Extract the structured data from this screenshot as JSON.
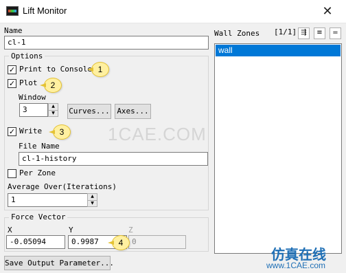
{
  "window": {
    "title": "Lift Monitor",
    "close_glyph": "✕"
  },
  "name_field": {
    "label": "Name",
    "value": "cl-1"
  },
  "options": {
    "title": "Options",
    "print_to_console": {
      "label": "Print to Console",
      "checked": true
    },
    "plot": {
      "label": "Plot",
      "checked": true
    },
    "window_label": "Window",
    "window_value": "3",
    "curves_button": "Curves...",
    "axes_button": "Axes...",
    "write": {
      "label": "Write",
      "checked": true
    },
    "file_name_label": "File Name",
    "file_name_value": "cl-1-history",
    "per_zone": {
      "label": "Per Zone",
      "checked": false
    },
    "average_over_label": "Average Over(Iterations)",
    "average_over_value": "1"
  },
  "force_vector": {
    "title": "Force Vector",
    "x_label": "X",
    "x_value": "-0.05094",
    "y_label": "Y",
    "y_value": "0.9987",
    "z_label": "Z",
    "z_value": "0"
  },
  "save_button": "Save Output Parameter...",
  "wall_zones": {
    "label": "Wall Zones",
    "count": "[1/1]",
    "items": [
      "wall"
    ],
    "selected": "wall"
  },
  "callouts": [
    "1",
    "2",
    "3",
    "4"
  ],
  "watermark": {
    "main": "1CAE.COM",
    "cn": "仿真在线",
    "url": "www.1CAE.com"
  },
  "check_glyph": "✓",
  "colors": {
    "selection": "#0078d7",
    "callout_fill": "#fff0a0",
    "callout_border": "#e4c233"
  }
}
